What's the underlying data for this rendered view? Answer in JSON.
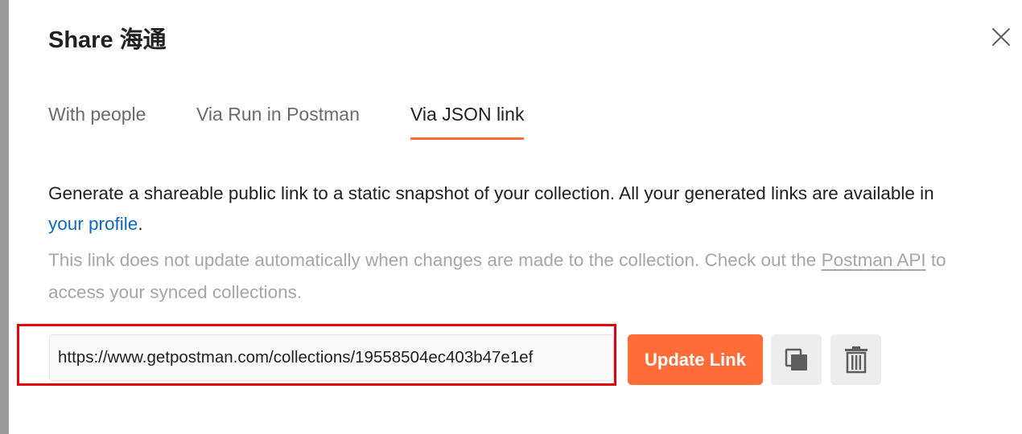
{
  "dialog": {
    "title": "Share 海通"
  },
  "tabs": [
    {
      "label": "With people",
      "active": false
    },
    {
      "label": "Via Run in Postman",
      "active": false
    },
    {
      "label": "Via JSON link",
      "active": true
    }
  ],
  "description": {
    "text_before": "Generate a shareable public link to a static snapshot of your collection. All your generated links are available in ",
    "link_label": "your profile",
    "text_after": "."
  },
  "note": {
    "text_before": "This link does not update automatically when changes are made to the collection. Check out the ",
    "link_label": "Postman API",
    "text_after": " to access your synced collections."
  },
  "link_field": {
    "value": "https://www.getpostman.com/collections/19558504ec403b47e1ef"
  },
  "actions": {
    "update_label": "Update Link",
    "copy_icon": "copy-icon",
    "delete_icon": "trash-icon",
    "close_icon": "close-icon"
  },
  "colors": {
    "accent": "#ff6c37",
    "link": "#0b67c9",
    "highlight": "#e3030b",
    "muted_text": "#a6a6a6"
  }
}
